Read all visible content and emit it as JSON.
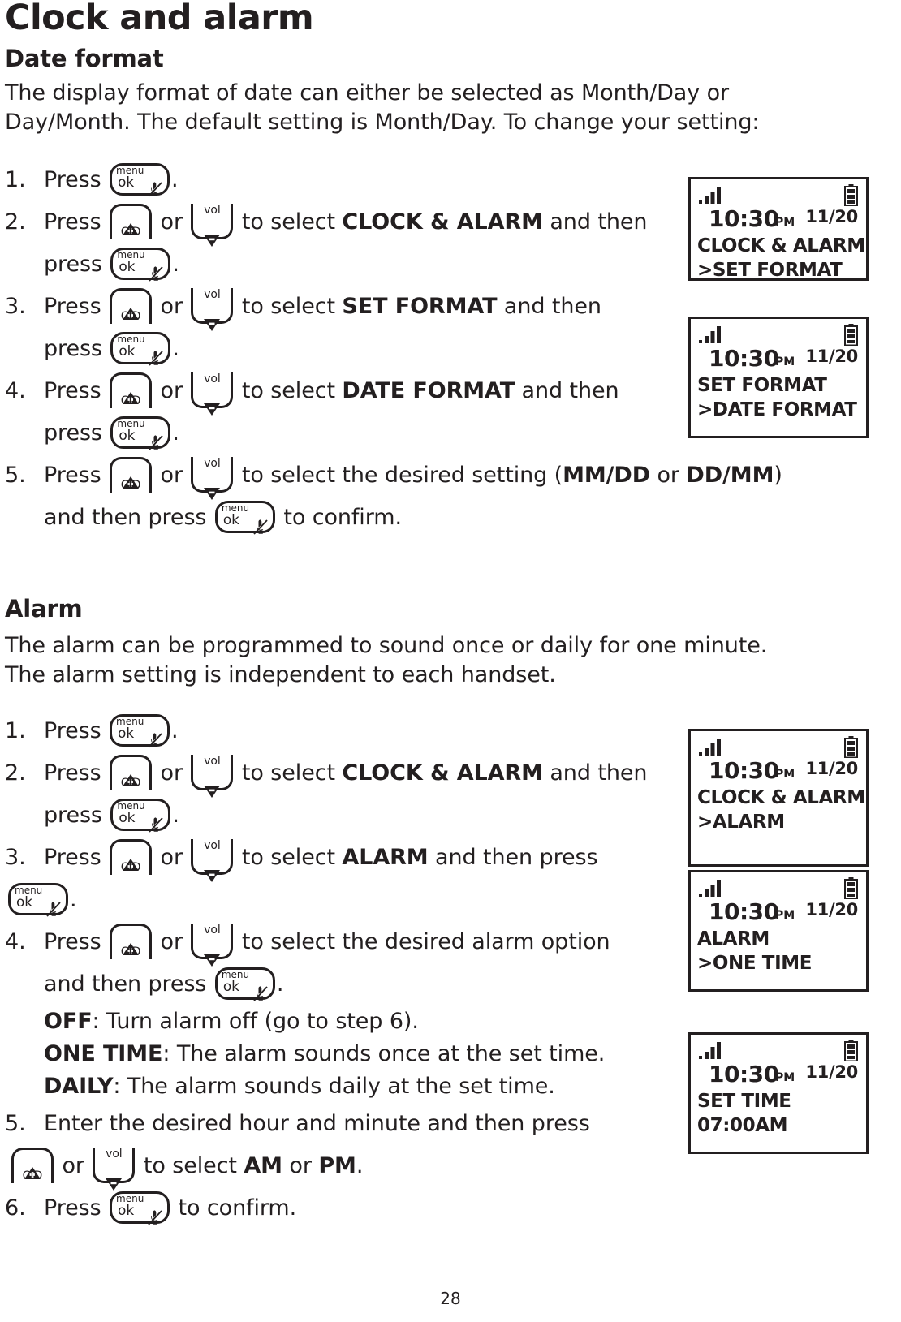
{
  "document": {
    "page_number": "28",
    "title": "Clock and alarm"
  },
  "sections": {
    "date_format": {
      "heading": "Date format",
      "intro_lines": [
        "The display format of date can either be selected as Month/Day or",
        "Day/Month. The default setting is Month/Day. To change your setting:"
      ],
      "steps": [
        {
          "num": "1.",
          "parts": [
            "Press ",
            "[menu-ok]",
            "."
          ]
        },
        {
          "num": "2.",
          "line1_a": "Press ",
          "line1_b": " or ",
          "line1_c": " to select ",
          "line1_bold": "CLOCK & ALARM",
          "line1_d": " and then",
          "line2_a": "press ",
          "line2_b": "."
        },
        {
          "num": "3.",
          "line1_a": "Press ",
          "line1_b": " or ",
          "line1_c": " to select ",
          "line1_bold": "SET FORMAT",
          "line1_d": " and then",
          "line2_a": "press ",
          "line2_b": "."
        },
        {
          "num": "4.",
          "line1_a": "Press ",
          "line1_b": " or ",
          "line1_c": " to select ",
          "line1_bold": "DATE FORMAT",
          "line1_d": " and then",
          "line2_a": "press ",
          "line2_b": "."
        },
        {
          "num": "5.",
          "line1_a": "Press ",
          "line1_b": " or ",
          "line1_c": " to select the desired setting (",
          "line1_bold1": "MM/DD",
          "line1_mid": " or ",
          "line1_bold2": "DD/MM",
          "line1_d": ")",
          "line2_a": "and then press ",
          "line2_b": " to confirm."
        }
      ]
    },
    "alarm": {
      "heading": "Alarm",
      "intro_lines": [
        "The alarm can be programmed to sound once or daily for one minute.",
        "The alarm setting is independent to each handset."
      ],
      "steps": [
        {
          "num": "1.",
          "line1_a": "Press ",
          "line1_b": "."
        },
        {
          "num": "2.",
          "line1_a": "Press ",
          "line1_b": " or ",
          "line1_c": " to select ",
          "line1_bold": "CLOCK & ALARM",
          "line1_d": " and then",
          "line2_a": "press ",
          "line2_b": "."
        },
        {
          "num": "3.",
          "line1_a": "Press ",
          "line1_b": " or ",
          "line1_c": " to select ",
          "line1_bold": "ALARM",
          "line1_d": " and then press",
          "line2_b": "."
        },
        {
          "num": "4.",
          "line1_a": "Press ",
          "line1_b": " or ",
          "line1_c": " to select the desired alarm option",
          "line2_a": "and then press ",
          "line2_b": ".",
          "options": [
            {
              "label": "OFF",
              "desc": ": Turn alarm off (go to step 6)."
            },
            {
              "label": "ONE TIME",
              "desc": ": The alarm sounds once at the set time."
            },
            {
              "label": "DAILY",
              "desc": ": The alarm sounds daily at the set time."
            }
          ]
        },
        {
          "num": "5.",
          "line1_a": "Enter the desired hour and minute and then press",
          "line2_b": " or ",
          "line2_c": " to select ",
          "line2_bold1": "AM",
          "line2_mid": " or ",
          "line2_bold2": "PM",
          "line2_d": "."
        },
        {
          "num": "6.",
          "line1_a": "Press ",
          "line1_b": " to confirm."
        }
      ]
    }
  },
  "keys": {
    "menu_ok": {
      "top_label": "menu",
      "bottom_label": "ok",
      "icon": "mute-mic-icon"
    },
    "cid_up": {
      "label": "CID",
      "icon": "triangle-up-plus-icon"
    },
    "vol_down": {
      "label": "vol",
      "icon": "triangle-down-minus-icon"
    }
  },
  "lcd_screens": [
    {
      "id": "lcd-1",
      "signal_icon": "signal-bars-icon",
      "battery_icon": "battery-icon",
      "time": "10:30",
      "ampm": "PM",
      "date": "11/20",
      "line1": "CLOCK & ALARM",
      "line2": ">SET FORMAT"
    },
    {
      "id": "lcd-2",
      "signal_icon": "signal-bars-icon",
      "battery_icon": "battery-icon",
      "time": "10:30",
      "ampm": "PM",
      "date": "11/20",
      "line1": "SET FORMAT",
      "line2": ">DATE FORMAT"
    },
    {
      "id": "lcd-3",
      "signal_icon": "signal-bars-icon",
      "battery_icon": "battery-icon",
      "time": "10:30",
      "ampm": "PM",
      "date": "11/20",
      "line1": "CLOCK & ALARM",
      "line2": ">ALARM"
    },
    {
      "id": "lcd-4",
      "signal_icon": "signal-bars-icon",
      "battery_icon": "battery-icon",
      "time": "10:30",
      "ampm": "PM",
      "date": "11/20",
      "line1": "ALARM",
      "line2": ">ONE TIME"
    },
    {
      "id": "lcd-5",
      "signal_icon": "signal-bars-icon",
      "battery_icon": "battery-icon",
      "time": "10:30",
      "ampm": "PM",
      "date": "11/20",
      "line1": "SET TIME",
      "line2": "07:00AM"
    }
  ],
  "colors": {
    "ink": "#231f20",
    "paper": "#ffffff"
  }
}
